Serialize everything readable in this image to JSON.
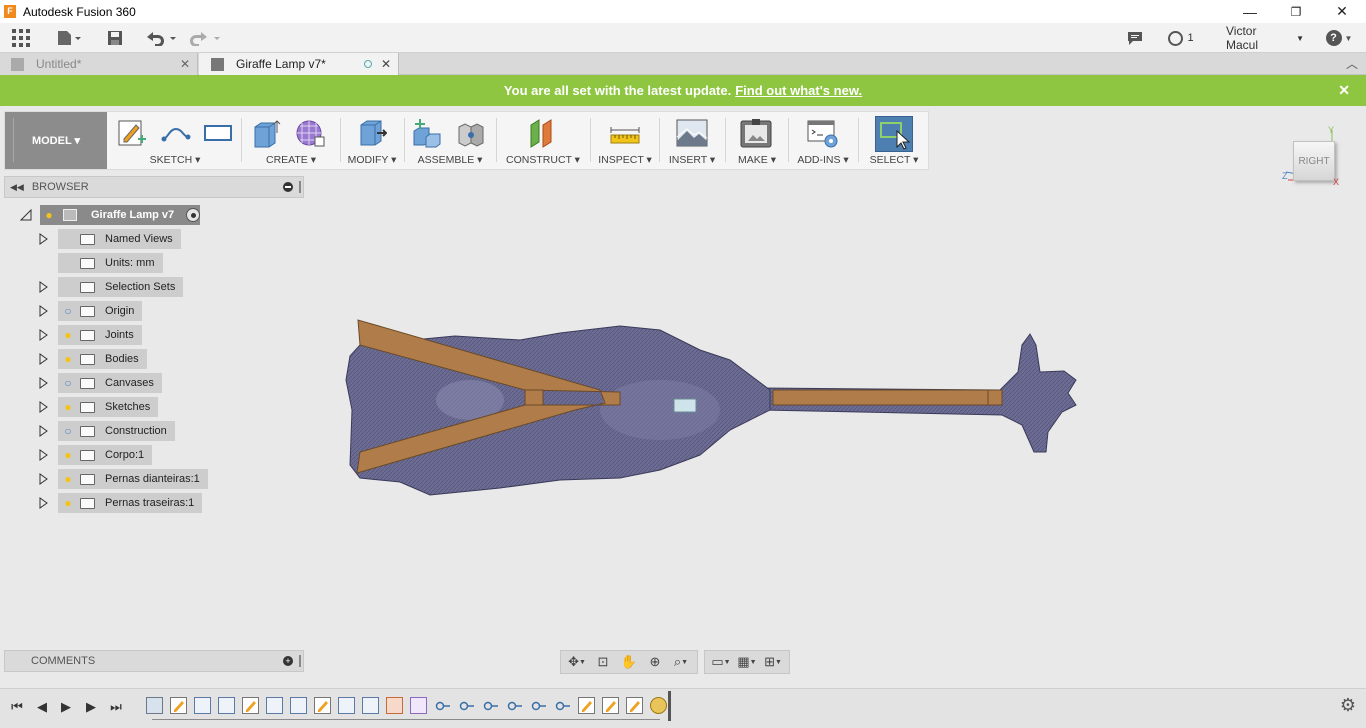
{
  "app": {
    "window_title": "Autodesk Fusion 360",
    "minimize": "—",
    "maximize": "❐",
    "close": "✕"
  },
  "qat": {
    "user_name": "Victor Macul",
    "jobs_count": "1",
    "help": "?"
  },
  "tabs": [
    {
      "label": "Untitled*",
      "active": false
    },
    {
      "label": "Giraffe Lamp v7*",
      "active": true
    }
  ],
  "banner": {
    "text": "You are all set with the latest update.",
    "link": "Find out what's new.",
    "close": "✕"
  },
  "toolbar": {
    "workspace": "MODEL ▾",
    "groups": [
      {
        "label": "SKETCH ▾"
      },
      {
        "label": "CREATE ▾"
      },
      {
        "label": "MODIFY ▾"
      },
      {
        "label": "ASSEMBLE ▾"
      },
      {
        "label": "CONSTRUCT ▾"
      },
      {
        "label": "INSPECT ▾"
      },
      {
        "label": "INSERT ▾"
      },
      {
        "label": "MAKE ▾"
      },
      {
        "label": "ADD-INS ▾"
      },
      {
        "label": "SELECT ▾"
      }
    ]
  },
  "browser": {
    "title": "BROWSER",
    "root": "Giraffe Lamp v7",
    "items": [
      {
        "label": "Named Views",
        "expander": true,
        "bulb": "none"
      },
      {
        "label": "Units: mm",
        "expander": false,
        "bulb": "none"
      },
      {
        "label": "Selection Sets",
        "expander": true,
        "bulb": "none"
      },
      {
        "label": "Origin",
        "expander": true,
        "bulb": "blue"
      },
      {
        "label": "Joints",
        "expander": true,
        "bulb": "yellow"
      },
      {
        "label": "Bodies",
        "expander": true,
        "bulb": "yellow"
      },
      {
        "label": "Canvases",
        "expander": true,
        "bulb": "blue"
      },
      {
        "label": "Sketches",
        "expander": true,
        "bulb": "yellow"
      },
      {
        "label": "Construction",
        "expander": true,
        "bulb": "blue"
      },
      {
        "label": "Corpo:1",
        "expander": true,
        "bulb": "yellow"
      },
      {
        "label": "Pernas dianteiras:1",
        "expander": true,
        "bulb": "yellow"
      },
      {
        "label": "Pernas traseiras:1",
        "expander": true,
        "bulb": "yellow"
      }
    ]
  },
  "comments": {
    "title": "COMMENTS"
  },
  "viewcube": {
    "face": "RIGHT",
    "x": "X",
    "y": "Y",
    "z": "Z"
  },
  "colors": {
    "banner": "#8ec641",
    "select_active": "#4d7fb0",
    "giraffe_mesh": "#6c6c94",
    "wood": "#b07d4a",
    "bulb_yellow": "#f2c318",
    "bulb_blue": "#4f86c6"
  }
}
